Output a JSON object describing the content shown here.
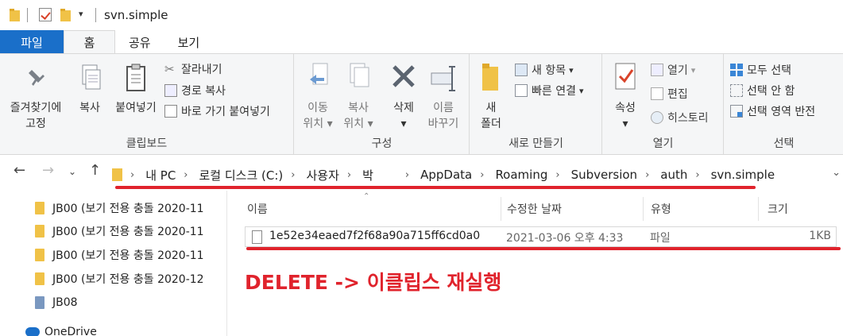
{
  "window": {
    "title": "svn.simple"
  },
  "quick_access": {
    "icons": [
      "folder-icon",
      "properties-check-icon",
      "new-folder-icon",
      "customize-arrow-icon"
    ]
  },
  "ribbon_tabs": [
    "파일",
    "홈",
    "공유",
    "보기"
  ],
  "ribbon": {
    "clipboard": {
      "label": "클립보드",
      "pin": [
        "즐겨찾기에",
        "고정"
      ],
      "copy": "복사",
      "paste": "붙여넣기",
      "cut": "잘라내기",
      "copy_path": "경로 복사",
      "paste_shortcut": "바로 가기 붙여넣기"
    },
    "organize": {
      "label": "구성",
      "move_to": [
        "이동",
        "위치"
      ],
      "copy_to": [
        "복사",
        "위치"
      ],
      "delete": "삭제",
      "rename": [
        "이름",
        "바꾸기"
      ]
    },
    "new": {
      "label": "새로 만들기",
      "new_folder": [
        "새",
        "폴더"
      ],
      "new_item": "새 항목",
      "easy_access": "빠른 연결"
    },
    "open": {
      "label": "열기",
      "properties": "속성",
      "open": "열기",
      "edit": "편집",
      "history": "히스토리"
    },
    "select": {
      "label": "선택",
      "select_all": "모두 선택",
      "select_none": "선택 안 함",
      "invert": "선택 영역 반전"
    }
  },
  "address": {
    "crumbs": [
      "내 PC",
      "로컬 디스크 (C:)",
      "사용자",
      "박",
      "AppData",
      "Roaming",
      "Subversion",
      "auth",
      "svn.simple"
    ]
  },
  "nav_pane": {
    "items": [
      "JB00 (보기 전용 충돌 2020-11",
      "JB00 (보기 전용 충돌 2020-11",
      "JB00 (보기 전용 충돌 2020-11",
      "JB00 (보기 전용 충돌 2020-12",
      "JB08",
      "OneDrive"
    ]
  },
  "file_list": {
    "columns": [
      "이름",
      "수정한 날짜",
      "유형",
      "크기"
    ],
    "rows": [
      {
        "name": "1e52e34eaed7f2f68a90a715ff6cd0a0",
        "date": "2021-03-06 오후 4:33",
        "type": "파일",
        "size": "1KB"
      }
    ]
  },
  "annotation": {
    "text": "DELETE -> 이클립스 재실행",
    "color": "#e0232c"
  },
  "colors": {
    "file_tab": "#1a6fc9",
    "annotation_red": "#e0232c",
    "folder_yellow": "#f0c247"
  }
}
